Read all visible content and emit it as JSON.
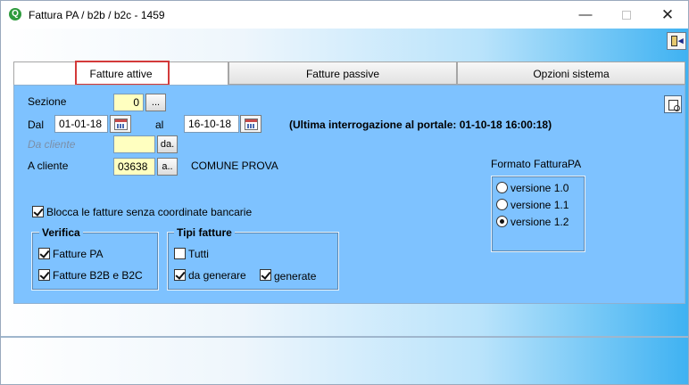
{
  "window": {
    "title": "Fattura PA / b2b / b2c - 1459",
    "minimize_glyph": "—",
    "close_glyph": "✕"
  },
  "tabs": [
    {
      "label": "Fatture attive",
      "active": true
    },
    {
      "label": "Fatture passive",
      "active": false
    },
    {
      "label": "Opzioni sistema",
      "active": false
    }
  ],
  "form": {
    "sezione_label": "Sezione",
    "sezione_value": "0",
    "sezione_btn": "...",
    "dal_label": "Dal",
    "dal_value": "01-01-18",
    "al_label": "al",
    "al_value": "16-10-18",
    "ultima_interrogazione": "(Ultima interrogazione al portale: 01-10-18 16:00:18)",
    "da_cliente_label": "Da cliente",
    "da_cliente_value": "",
    "da_cliente_btn": "da.",
    "a_cliente_label": "A cliente",
    "a_cliente_value": "03638",
    "a_cliente_btn": "a..",
    "cliente_name": "COMUNE PROVA",
    "blocca_label": "Blocca le fatture senza coordinate bancarie",
    "blocca_checked": true
  },
  "verifica": {
    "title": "Verifica",
    "items": [
      {
        "label": "Fatture PA",
        "checked": true
      },
      {
        "label": "Fatture B2B e B2C",
        "checked": true
      }
    ]
  },
  "tipi_fatture": {
    "title": "Tipi fatture",
    "tutti": {
      "label": "Tutti",
      "checked": false
    },
    "da_generare": {
      "label": "da generare",
      "checked": true
    },
    "generate": {
      "label": "generate",
      "checked": true
    }
  },
  "formato": {
    "title": "Formato FatturaPA",
    "options": [
      {
        "label": "versione 1.0",
        "selected": false
      },
      {
        "label": "versione 1.1",
        "selected": false
      },
      {
        "label": "versione 1.2",
        "selected": true
      }
    ]
  },
  "colors": {
    "panel": "#7ec2ff",
    "input_yellow": "#ffffc0",
    "tab_highlight": "#d33a3a"
  },
  "icons": [
    "app-icon",
    "exit-icon",
    "calendar-icon",
    "print-preview-icon"
  ]
}
